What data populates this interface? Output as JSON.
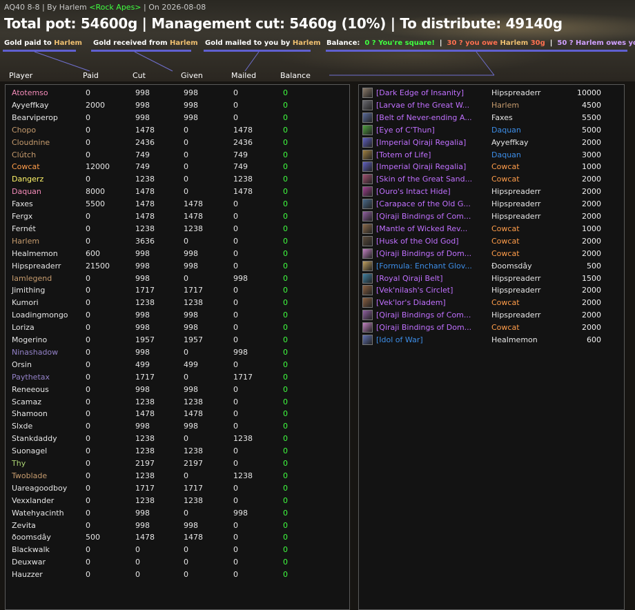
{
  "header": {
    "title_prefix": "AQ40 8-8 | By Harlem ",
    "guild": "<Rock Apes>",
    "title_suffix": " | On 2026-08-08",
    "totals": "Total pot: 54600g | Management cut: 5460g (10%) | To distribute: 49140g"
  },
  "legend": {
    "paid_label": "Gold paid to ",
    "received_label": "Gold received from ",
    "mailed_label": "Gold mailed to you by ",
    "name": "Harlem",
    "balance_label": "Balance:",
    "zero": "0 ? You're square!",
    "sep": "|",
    "neg_text": "30 ? you owe ",
    "neg_amount": "30g",
    "pos_text": "50 ? Harlem owes you 50g",
    "colors": {
      "zero": "#40ff40",
      "neg": "#ff7050",
      "pos": "#d0a0ff",
      "name": "#f0c070"
    }
  },
  "columns": {
    "player": "Player",
    "paid": "Paid",
    "cut": "Cut",
    "given": "Given",
    "mailed": "Mailed",
    "balance": "Balance"
  },
  "players": [
    {
      "name": "Atotemso",
      "color": "#f58cba",
      "paid": "0",
      "cut": "998",
      "given": "998",
      "mailed": "0",
      "balance": "0"
    },
    {
      "name": "Ayyeffkay",
      "color": "#e6e6e6",
      "paid": "2000",
      "cut": "998",
      "given": "998",
      "mailed": "0",
      "balance": "0"
    },
    {
      "name": "Bearviperop",
      "color": "#e6e6e6",
      "paid": "0",
      "cut": "998",
      "given": "998",
      "mailed": "0",
      "balance": "0"
    },
    {
      "name": "Chopo",
      "color": "#c79c6e",
      "paid": "0",
      "cut": "1478",
      "given": "0",
      "mailed": "1478",
      "balance": "0"
    },
    {
      "name": "Cloudnine",
      "color": "#c79c6e",
      "paid": "0",
      "cut": "2436",
      "given": "0",
      "mailed": "2436",
      "balance": "0"
    },
    {
      "name": "Clútch",
      "color": "#c79c6e",
      "paid": "0",
      "cut": "749",
      "given": "0",
      "mailed": "749",
      "balance": "0"
    },
    {
      "name": "Cowcat",
      "color": "#ff9d4a",
      "paid": "12000",
      "cut": "749",
      "given": "0",
      "mailed": "749",
      "balance": "0"
    },
    {
      "name": "Dangerz",
      "color": "#fff569",
      "paid": "0",
      "cut": "1238",
      "given": "0",
      "mailed": "1238",
      "balance": "0"
    },
    {
      "name": "Daquan",
      "color": "#f58cba",
      "paid": "8000",
      "cut": "1478",
      "given": "0",
      "mailed": "1478",
      "balance": "0"
    },
    {
      "name": "Faxes",
      "color": "#e6e6e6",
      "paid": "5500",
      "cut": "1478",
      "given": "1478",
      "mailed": "0",
      "balance": "0"
    },
    {
      "name": "Fergx",
      "color": "#e6e6e6",
      "paid": "0",
      "cut": "1478",
      "given": "1478",
      "mailed": "0",
      "balance": "0"
    },
    {
      "name": "Fernét",
      "color": "#e6e6e6",
      "paid": "0",
      "cut": "1238",
      "given": "1238",
      "mailed": "0",
      "balance": "0"
    },
    {
      "name": "Harlem",
      "color": "#c79c6e",
      "paid": "0",
      "cut": "3636",
      "given": "0",
      "mailed": "0",
      "balance": "0"
    },
    {
      "name": "Healmemon",
      "color": "#e6e6e6",
      "paid": "600",
      "cut": "998",
      "given": "998",
      "mailed": "0",
      "balance": "0"
    },
    {
      "name": "Hipspreaderr",
      "color": "#e6e6e6",
      "paid": "21500",
      "cut": "998",
      "given": "998",
      "mailed": "0",
      "balance": "0"
    },
    {
      "name": "Iamlegend",
      "color": "#c79c6e",
      "paid": "0",
      "cut": "998",
      "given": "0",
      "mailed": "998",
      "balance": "0"
    },
    {
      "name": "Jimithing",
      "color": "#e6e6e6",
      "paid": "0",
      "cut": "1717",
      "given": "1717",
      "mailed": "0",
      "balance": "0"
    },
    {
      "name": "Kumori",
      "color": "#e6e6e6",
      "paid": "0",
      "cut": "1238",
      "given": "1238",
      "mailed": "0",
      "balance": "0"
    },
    {
      "name": "Loadingmongo",
      "color": "#e6e6e6",
      "paid": "0",
      "cut": "998",
      "given": "998",
      "mailed": "0",
      "balance": "0"
    },
    {
      "name": "Loriza",
      "color": "#e6e6e6",
      "paid": "0",
      "cut": "998",
      "given": "998",
      "mailed": "0",
      "balance": "0"
    },
    {
      "name": "Mogerino",
      "color": "#e6e6e6",
      "paid": "0",
      "cut": "1957",
      "given": "1957",
      "mailed": "0",
      "balance": "0"
    },
    {
      "name": "Ninashadow",
      "color": "#9482c9",
      "paid": "0",
      "cut": "998",
      "given": "0",
      "mailed": "998",
      "balance": "0"
    },
    {
      "name": "Orsin",
      "color": "#e6e6e6",
      "paid": "0",
      "cut": "499",
      "given": "499",
      "mailed": "0",
      "balance": "0"
    },
    {
      "name": "Paythetax",
      "color": "#9482c9",
      "paid": "0",
      "cut": "1717",
      "given": "0",
      "mailed": "1717",
      "balance": "0"
    },
    {
      "name": "Reneeous",
      "color": "#e6e6e6",
      "paid": "0",
      "cut": "998",
      "given": "998",
      "mailed": "0",
      "balance": "0"
    },
    {
      "name": "Scamaz",
      "color": "#e6e6e6",
      "paid": "0",
      "cut": "1238",
      "given": "1238",
      "mailed": "0",
      "balance": "0"
    },
    {
      "name": "Shamoon",
      "color": "#e6e6e6",
      "paid": "0",
      "cut": "1478",
      "given": "1478",
      "mailed": "0",
      "balance": "0"
    },
    {
      "name": "Slxde",
      "color": "#e6e6e6",
      "paid": "0",
      "cut": "998",
      "given": "998",
      "mailed": "0",
      "balance": "0"
    },
    {
      "name": "Stankdaddy",
      "color": "#e6e6e6",
      "paid": "0",
      "cut": "1238",
      "given": "0",
      "mailed": "1238",
      "balance": "0"
    },
    {
      "name": "Suonagel",
      "color": "#e6e6e6",
      "paid": "0",
      "cut": "1238",
      "given": "1238",
      "mailed": "0",
      "balance": "0"
    },
    {
      "name": "Thy",
      "color": "#abd473",
      "paid": "0",
      "cut": "2197",
      "given": "2197",
      "mailed": "0",
      "balance": "0"
    },
    {
      "name": "Twoblade",
      "color": "#c79c6e",
      "paid": "0",
      "cut": "1238",
      "given": "0",
      "mailed": "1238",
      "balance": "0"
    },
    {
      "name": "Uareagoodboy",
      "color": "#e6e6e6",
      "paid": "0",
      "cut": "1717",
      "given": "1717",
      "mailed": "0",
      "balance": "0"
    },
    {
      "name": "Vexxlander",
      "color": "#e6e6e6",
      "paid": "0",
      "cut": "1238",
      "given": "1238",
      "mailed": "0",
      "balance": "0"
    },
    {
      "name": "Watehyacinth",
      "color": "#e6e6e6",
      "paid": "0",
      "cut": "998",
      "given": "0",
      "mailed": "998",
      "balance": "0"
    },
    {
      "name": "Zevita",
      "color": "#e6e6e6",
      "paid": "0",
      "cut": "998",
      "given": "998",
      "mailed": "0",
      "balance": "0"
    },
    {
      "name": "ðoomsdây",
      "color": "#e6e6e6",
      "paid": "500",
      "cut": "1478",
      "given": "1478",
      "mailed": "0",
      "balance": "0"
    },
    {
      "name": "Blackwalk",
      "color": "#e6e6e6",
      "paid": "0",
      "cut": "0",
      "given": "0",
      "mailed": "0",
      "balance": "0"
    },
    {
      "name": "Deuxwar",
      "color": "#e6e6e6",
      "paid": "0",
      "cut": "0",
      "given": "0",
      "mailed": "0",
      "balance": "0"
    },
    {
      "name": "Hauzzer",
      "color": "#e6e6e6",
      "paid": "0",
      "cut": "0",
      "given": "0",
      "mailed": "0",
      "balance": "0"
    }
  ],
  "items": [
    {
      "name": "[Dark Edge of Insanity]",
      "quality": "#c070ff",
      "winner": "Hipspreaderr",
      "winner_color": "#e6e6e6",
      "amount": "10000",
      "icon": "sword-icon",
      "icon_color": "#8a7a6a"
    },
    {
      "name": "[Larvae of the Great W...",
      "quality": "#c070ff",
      "winner": "Harlem",
      "winner_color": "#c79c6e",
      "amount": "4500",
      "icon": "larvae-icon",
      "icon_color": "#6a6a70"
    },
    {
      "name": "[Belt of Never-ending A...",
      "quality": "#c070ff",
      "winner": "Faxes",
      "winner_color": "#e6e6e6",
      "amount": "5500",
      "icon": "belt-icon",
      "icon_color": "#5a6a9a"
    },
    {
      "name": "[Eye of C'Thun]",
      "quality": "#c070ff",
      "winner": "Daquan",
      "winner_color": "#3d8ee8",
      "amount": "5000",
      "icon": "eye-icon",
      "icon_color": "#50a040"
    },
    {
      "name": "[Imperial Qiraji Regalia]",
      "quality": "#c070ff",
      "winner": "Ayyeffkay",
      "winner_color": "#e6e6e6",
      "amount": "2000",
      "icon": "scepter-icon",
      "icon_color": "#6060c0"
    },
    {
      "name": "[Totem of Life]",
      "quality": "#c070ff",
      "winner": "Daquan",
      "winner_color": "#3d8ee8",
      "amount": "3000",
      "icon": "totem-icon",
      "icon_color": "#a08040"
    },
    {
      "name": "[Imperial Qiraji Regalia]",
      "quality": "#c070ff",
      "winner": "Cowcat",
      "winner_color": "#ff9d4a",
      "amount": "1000",
      "icon": "scepter-icon",
      "icon_color": "#6060c0"
    },
    {
      "name": "[Skin of the Great Sand...",
      "quality": "#c070ff",
      "winner": "Cowcat",
      "winner_color": "#ff9d4a",
      "amount": "2000",
      "icon": "skin-icon",
      "icon_color": "#a05070"
    },
    {
      "name": "[Ouro's Intact Hide]",
      "quality": "#c070ff",
      "winner": "Hipspreaderr",
      "winner_color": "#e6e6e6",
      "amount": "2000",
      "icon": "hide-icon",
      "icon_color": "#a04090"
    },
    {
      "name": "[Carapace of the Old G...",
      "quality": "#c070ff",
      "winner": "Hipspreaderr",
      "winner_color": "#e6e6e6",
      "amount": "2000",
      "icon": "carapace-icon",
      "icon_color": "#4a6a8a"
    },
    {
      "name": "[Qiraji Bindings of Com...",
      "quality": "#c070ff",
      "winner": "Hipspreaderr",
      "winner_color": "#e6e6e6",
      "amount": "2000",
      "icon": "bindings-icon",
      "icon_color": "#9060a0"
    },
    {
      "name": "[Mantle of Wicked Rev...",
      "quality": "#c070ff",
      "winner": "Cowcat",
      "winner_color": "#ff9d4a",
      "amount": "1000",
      "icon": "mantle-icon",
      "icon_color": "#8a6a4a"
    },
    {
      "name": "[Husk of the Old God]",
      "quality": "#c070ff",
      "winner": "Cowcat",
      "winner_color": "#ff9d4a",
      "amount": "2000",
      "icon": "husk-icon",
      "icon_color": "#5a4a3a"
    },
    {
      "name": "[Qiraji Bindings of Dom...",
      "quality": "#c070ff",
      "winner": "Cowcat",
      "winner_color": "#ff9d4a",
      "amount": "2000",
      "icon": "bindings-icon",
      "icon_color": "#c080c0"
    },
    {
      "name": "[Formula: Enchant Glov...",
      "quality": "#3d8ee8",
      "winner": "Ðoomsdây",
      "winner_color": "#e6e6e6",
      "amount": "500",
      "icon": "scroll-icon",
      "icon_color": "#c0a060"
    },
    {
      "name": "[Royal Qiraji Belt]",
      "quality": "#c070ff",
      "winner": "Hipspreaderr",
      "winner_color": "#e6e6e6",
      "amount": "1500",
      "icon": "belt-icon",
      "icon_color": "#4080a0"
    },
    {
      "name": "[Vek'nilash's Circlet]",
      "quality": "#c070ff",
      "winner": "Hipspreaderr",
      "winner_color": "#e6e6e6",
      "amount": "2000",
      "icon": "circlet-icon",
      "icon_color": "#8a6040"
    },
    {
      "name": "[Vek'lor's Diadem]",
      "quality": "#c070ff",
      "winner": "Cowcat",
      "winner_color": "#ff9d4a",
      "amount": "2000",
      "icon": "diadem-icon",
      "icon_color": "#8a6040"
    },
    {
      "name": "[Qiraji Bindings of Com...",
      "quality": "#c070ff",
      "winner": "Hipspreaderr",
      "winner_color": "#e6e6e6",
      "amount": "2000",
      "icon": "bindings-icon",
      "icon_color": "#9060a0"
    },
    {
      "name": "[Qiraji Bindings of Dom...",
      "quality": "#c070ff",
      "winner": "Cowcat",
      "winner_color": "#ff9d4a",
      "amount": "2000",
      "icon": "bindings-icon",
      "icon_color": "#c080c0"
    },
    {
      "name": "[Idol of War]",
      "quality": "#3d8ee8",
      "winner": "Healmemon",
      "winner_color": "#e6e6e6",
      "amount": "600",
      "icon": "idol-icon",
      "icon_color": "#6070b0"
    }
  ]
}
